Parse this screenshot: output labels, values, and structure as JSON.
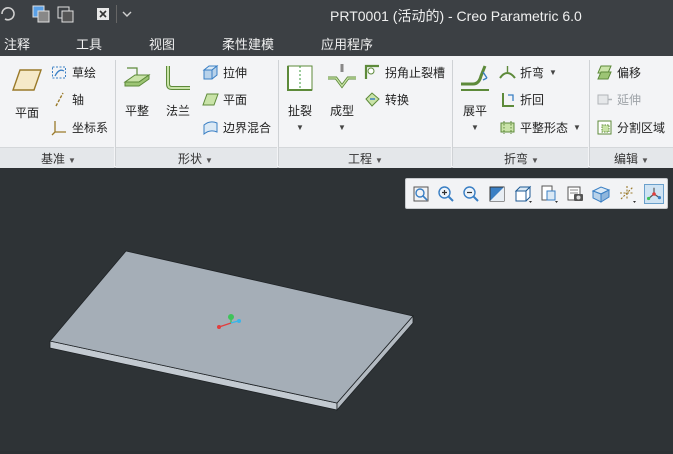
{
  "titlebar": {
    "title": "PRT0001 (活动的) - Creo Parametric 6.0"
  },
  "menubar": {
    "items": [
      {
        "label": "注释"
      },
      {
        "label": "工具"
      },
      {
        "label": "视图"
      },
      {
        "label": "柔性建模"
      },
      {
        "label": "应用程序"
      }
    ]
  },
  "ribbon": {
    "groups": {
      "datum": {
        "label": "基准",
        "plane": "平面",
        "sketch": "草绘",
        "axis": "轴",
        "csys": "坐标系"
      },
      "shapes": {
        "label": "形状",
        "flat": "平整",
        "flange": "法兰",
        "extrude": "拉伸",
        "plane": "平面",
        "blend": "边界混合"
      },
      "engineering": {
        "label": "工程",
        "rip": "扯裂",
        "form": "成型",
        "corner_relief": "拐角止裂槽",
        "convert": "转换"
      },
      "bends": {
        "label": "折弯",
        "unbend": "展平",
        "bend": "折弯",
        "bend_back": "折回",
        "flat_pattern": "平整形态"
      },
      "editing": {
        "label": "编辑",
        "offset": "偏移",
        "extend": "延伸",
        "split_area": "分割区域"
      }
    }
  },
  "view_toolbar": {
    "icons": [
      "refit-icon",
      "zoom-in-icon",
      "zoom-out-icon",
      "repaint-icon",
      "display-style-icon",
      "saved-orientations-icon",
      "view-manager-icon",
      "perspective-icon",
      "datum-display-icon",
      "spin-center-icon"
    ]
  },
  "colors": {
    "title_bg": "#3c4044",
    "ribbon_bg": "#f3f4f6",
    "canvas_bg": "#2e3336",
    "plate_top": "#a5aeb7",
    "plate_side": "#c3cad1",
    "axis_x": "#e23d3d",
    "axis_y": "#3ec35a",
    "axis_z": "#3ab4e8"
  }
}
